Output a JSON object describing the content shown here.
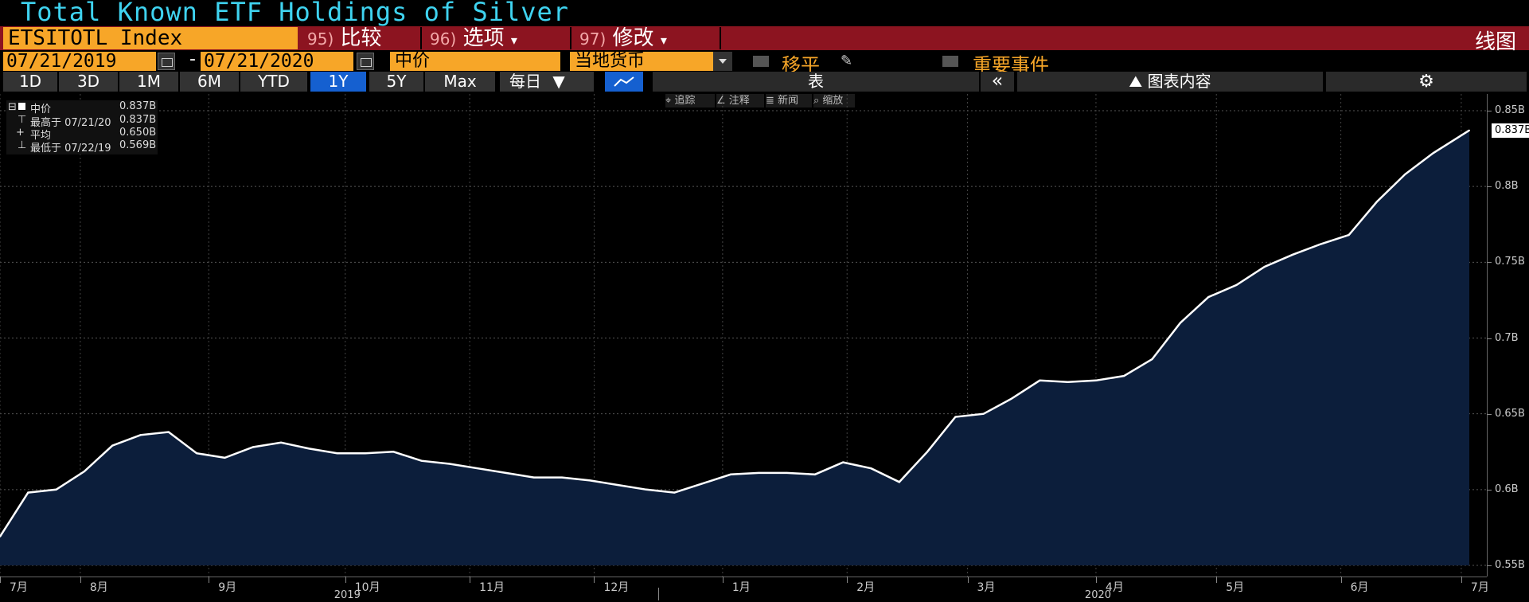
{
  "header": {
    "title": "Total Known ETF Holdings of Silver",
    "ticker": "ETSITOTL Index",
    "buttons": [
      {
        "num": "95)",
        "label": "比较"
      },
      {
        "num": "96)",
        "label": "选项"
      },
      {
        "num": "97)",
        "label": "修改"
      }
    ],
    "view_label": "线图"
  },
  "controls": {
    "start_date": "07/21/2019",
    "dash": "-",
    "end_date": "07/21/2020",
    "price_field": "中价",
    "currency": "当地货币",
    "moving_avg": "移平",
    "key_events": "重要事件"
  },
  "periods": [
    "1D",
    "3D",
    "1M",
    "6M",
    "YTD",
    "1Y",
    "5Y",
    "Max"
  ],
  "active_period": "1Y",
  "toolbar": {
    "frequency": "每日",
    "table": "表",
    "collapse": "«",
    "chart_content": "图表内容",
    "settings_icon": "gear-icon"
  },
  "annotations": [
    "追踪",
    "注释",
    "新闻",
    "缩放"
  ],
  "legend": {
    "series": "中价",
    "series_value": "0.837B",
    "high_label": "最高于 07/21/20",
    "high_value": "0.837B",
    "avg_label": "平均",
    "avg_value": "0.650B",
    "low_label": "最低于 07/22/19",
    "low_value": "0.569B"
  },
  "last_value_label": "0.837B",
  "colors": {
    "title": "#3fd3f0",
    "orange": "#f7a628",
    "red_bar": "#8c1420",
    "active_blue": "#1560d0",
    "area_fill": "#0c1e3b",
    "line": "#ffffff"
  },
  "chart_data": {
    "type": "area",
    "x": [
      "2019-07-21",
      "2019-07-28",
      "2019-08-04",
      "2019-08-11",
      "2019-08-18",
      "2019-08-25",
      "2019-09-01",
      "2019-09-08",
      "2019-09-15",
      "2019-09-22",
      "2019-09-29",
      "2019-10-06",
      "2019-10-13",
      "2019-10-20",
      "2019-10-27",
      "2019-11-03",
      "2019-11-10",
      "2019-11-17",
      "2019-11-24",
      "2019-12-01",
      "2019-12-08",
      "2019-12-15",
      "2019-12-22",
      "2019-12-29",
      "2020-01-05",
      "2020-01-12",
      "2020-01-19",
      "2020-01-26",
      "2020-02-02",
      "2020-02-09",
      "2020-02-16",
      "2020-02-23",
      "2020-03-01",
      "2020-03-08",
      "2020-03-15",
      "2020-03-22",
      "2020-03-29",
      "2020-04-05",
      "2020-04-12",
      "2020-04-19",
      "2020-04-26",
      "2020-05-03",
      "2020-05-10",
      "2020-05-17",
      "2020-05-24",
      "2020-05-31",
      "2020-06-07",
      "2020-06-14",
      "2020-06-21",
      "2020-06-28",
      "2020-07-05",
      "2020-07-12",
      "2020-07-21"
    ],
    "values": [
      0.569,
      0.598,
      0.6,
      0.612,
      0.629,
      0.636,
      0.638,
      0.624,
      0.621,
      0.628,
      0.631,
      0.627,
      0.624,
      0.624,
      0.625,
      0.619,
      0.617,
      0.614,
      0.611,
      0.608,
      0.608,
      0.606,
      0.603,
      0.6,
      0.598,
      0.604,
      0.61,
      0.611,
      0.611,
      0.61,
      0.618,
      0.614,
      0.605,
      0.625,
      0.648,
      0.65,
      0.66,
      0.672,
      0.671,
      0.672,
      0.675,
      0.686,
      0.71,
      0.727,
      0.735,
      0.747,
      0.755,
      0.762,
      0.768,
      0.79,
      0.808,
      0.822,
      0.837
    ],
    "ylim": [
      0.55,
      0.85
    ],
    "yticks": [
      "0.55B",
      "0.6B",
      "0.65B",
      "0.7B",
      "0.75B",
      "0.8B",
      "0.85B"
    ],
    "ytick_values": [
      0.55,
      0.6,
      0.65,
      0.7,
      0.75,
      0.8,
      0.85
    ],
    "x_tick_labels": [
      "7月",
      "8月",
      "9月",
      "10月",
      "11月",
      "12月",
      "1月",
      "2月",
      "3月",
      "4月",
      "5月",
      "6月",
      "7月"
    ],
    "x_tick_dates": [
      "2019-07-21",
      "2019-08-10",
      "2019-09-11",
      "2019-10-15",
      "2019-11-15",
      "2019-12-16",
      "2020-01-17",
      "2020-02-17",
      "2020-03-18",
      "2020-04-19",
      "2020-05-19",
      "2020-06-19",
      "2020-07-19"
    ],
    "year_labels": [
      "2019",
      "2020"
    ],
    "year_label_dates": [
      "2019-10-15",
      "2020-04-19"
    ]
  }
}
